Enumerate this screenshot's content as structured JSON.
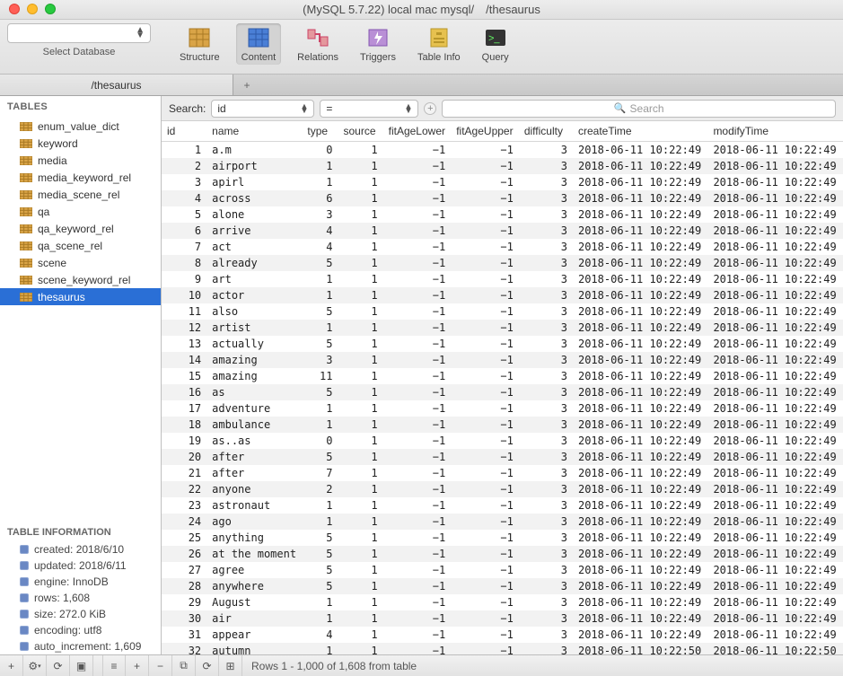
{
  "window": {
    "title": "(MySQL 5.7.22) local mac mysql/     /thesaurus"
  },
  "toolbar": {
    "selectDatabase": {
      "placeholder": "",
      "label": "Select Database"
    },
    "items": [
      {
        "key": "structure",
        "label": "Structure"
      },
      {
        "key": "content",
        "label": "Content"
      },
      {
        "key": "relations",
        "label": "Relations"
      },
      {
        "key": "triggers",
        "label": "Triggers"
      },
      {
        "key": "tableinfo",
        "label": "Table Info"
      },
      {
        "key": "query",
        "label": "Query"
      }
    ],
    "active": "content"
  },
  "tabs": {
    "items": [
      "/thesaurus"
    ]
  },
  "sidebar": {
    "heading": "TABLES",
    "tables": [
      "enum_value_dict",
      "keyword",
      "media",
      "media_keyword_rel",
      "media_scene_rel",
      "qa",
      "qa_keyword_rel",
      "qa_scene_rel",
      "scene",
      "scene_keyword_rel",
      "thesaurus"
    ],
    "selected": "thesaurus",
    "info": {
      "heading": "TABLE INFORMATION",
      "rows": [
        "created: 2018/6/10",
        "updated: 2018/6/11",
        "engine: InnoDB",
        "rows: 1,608",
        "size: 272.0 KiB",
        "encoding: utf8",
        "auto_increment: 1,609"
      ]
    }
  },
  "search": {
    "label": "Search:",
    "field": "id",
    "operator": "=",
    "placeholder": "Search"
  },
  "columns": [
    "id",
    "name",
    "type",
    "source",
    "fitAgeLower",
    "fitAgeUpper",
    "difficulty",
    "createTime",
    "modifyTime"
  ],
  "rows": [
    {
      "id": 1,
      "name": "a.m",
      "type": 0,
      "source": 1,
      "fitAgeLower": -1,
      "fitAgeUpper": -1,
      "difficulty": 3,
      "createTime": "2018-06-11 10:22:49",
      "modifyTime": "2018-06-11 10:22:49"
    },
    {
      "id": 2,
      "name": "airport",
      "type": 1,
      "source": 1,
      "fitAgeLower": -1,
      "fitAgeUpper": -1,
      "difficulty": 3,
      "createTime": "2018-06-11 10:22:49",
      "modifyTime": "2018-06-11 10:22:49"
    },
    {
      "id": 3,
      "name": "apirl",
      "type": 1,
      "source": 1,
      "fitAgeLower": -1,
      "fitAgeUpper": -1,
      "difficulty": 3,
      "createTime": "2018-06-11 10:22:49",
      "modifyTime": "2018-06-11 10:22:49"
    },
    {
      "id": 4,
      "name": "across",
      "type": 6,
      "source": 1,
      "fitAgeLower": -1,
      "fitAgeUpper": -1,
      "difficulty": 3,
      "createTime": "2018-06-11 10:22:49",
      "modifyTime": "2018-06-11 10:22:49"
    },
    {
      "id": 5,
      "name": "alone",
      "type": 3,
      "source": 1,
      "fitAgeLower": -1,
      "fitAgeUpper": -1,
      "difficulty": 3,
      "createTime": "2018-06-11 10:22:49",
      "modifyTime": "2018-06-11 10:22:49"
    },
    {
      "id": 6,
      "name": "arrive",
      "type": 4,
      "source": 1,
      "fitAgeLower": -1,
      "fitAgeUpper": -1,
      "difficulty": 3,
      "createTime": "2018-06-11 10:22:49",
      "modifyTime": "2018-06-11 10:22:49"
    },
    {
      "id": 7,
      "name": "act",
      "type": 4,
      "source": 1,
      "fitAgeLower": -1,
      "fitAgeUpper": -1,
      "difficulty": 3,
      "createTime": "2018-06-11 10:22:49",
      "modifyTime": "2018-06-11 10:22:49"
    },
    {
      "id": 8,
      "name": "already",
      "type": 5,
      "source": 1,
      "fitAgeLower": -1,
      "fitAgeUpper": -1,
      "difficulty": 3,
      "createTime": "2018-06-11 10:22:49",
      "modifyTime": "2018-06-11 10:22:49"
    },
    {
      "id": 9,
      "name": "art",
      "type": 1,
      "source": 1,
      "fitAgeLower": -1,
      "fitAgeUpper": -1,
      "difficulty": 3,
      "createTime": "2018-06-11 10:22:49",
      "modifyTime": "2018-06-11 10:22:49"
    },
    {
      "id": 10,
      "name": "actor",
      "type": 1,
      "source": 1,
      "fitAgeLower": -1,
      "fitAgeUpper": -1,
      "difficulty": 3,
      "createTime": "2018-06-11 10:22:49",
      "modifyTime": "2018-06-11 10:22:49"
    },
    {
      "id": 11,
      "name": "also",
      "type": 5,
      "source": 1,
      "fitAgeLower": -1,
      "fitAgeUpper": -1,
      "difficulty": 3,
      "createTime": "2018-06-11 10:22:49",
      "modifyTime": "2018-06-11 10:22:49"
    },
    {
      "id": 12,
      "name": "artist",
      "type": 1,
      "source": 1,
      "fitAgeLower": -1,
      "fitAgeUpper": -1,
      "difficulty": 3,
      "createTime": "2018-06-11 10:22:49",
      "modifyTime": "2018-06-11 10:22:49"
    },
    {
      "id": 13,
      "name": "actually",
      "type": 5,
      "source": 1,
      "fitAgeLower": -1,
      "fitAgeUpper": -1,
      "difficulty": 3,
      "createTime": "2018-06-11 10:22:49",
      "modifyTime": "2018-06-11 10:22:49"
    },
    {
      "id": 14,
      "name": "amazing",
      "type": 3,
      "source": 1,
      "fitAgeLower": -1,
      "fitAgeUpper": -1,
      "difficulty": 3,
      "createTime": "2018-06-11 10:22:49",
      "modifyTime": "2018-06-11 10:22:49"
    },
    {
      "id": 15,
      "name": "amazing",
      "type": 11,
      "source": 1,
      "fitAgeLower": -1,
      "fitAgeUpper": -1,
      "difficulty": 3,
      "createTime": "2018-06-11 10:22:49",
      "modifyTime": "2018-06-11 10:22:49"
    },
    {
      "id": 16,
      "name": "as",
      "type": 5,
      "source": 1,
      "fitAgeLower": -1,
      "fitAgeUpper": -1,
      "difficulty": 3,
      "createTime": "2018-06-11 10:22:49",
      "modifyTime": "2018-06-11 10:22:49"
    },
    {
      "id": 17,
      "name": "adventure",
      "type": 1,
      "source": 1,
      "fitAgeLower": -1,
      "fitAgeUpper": -1,
      "difficulty": 3,
      "createTime": "2018-06-11 10:22:49",
      "modifyTime": "2018-06-11 10:22:49"
    },
    {
      "id": 18,
      "name": "ambulance",
      "type": 1,
      "source": 1,
      "fitAgeLower": -1,
      "fitAgeUpper": -1,
      "difficulty": 3,
      "createTime": "2018-06-11 10:22:49",
      "modifyTime": "2018-06-11 10:22:49"
    },
    {
      "id": 19,
      "name": "as..as",
      "type": 0,
      "source": 1,
      "fitAgeLower": -1,
      "fitAgeUpper": -1,
      "difficulty": 3,
      "createTime": "2018-06-11 10:22:49",
      "modifyTime": "2018-06-11 10:22:49"
    },
    {
      "id": 20,
      "name": "after",
      "type": 5,
      "source": 1,
      "fitAgeLower": -1,
      "fitAgeUpper": -1,
      "difficulty": 3,
      "createTime": "2018-06-11 10:22:49",
      "modifyTime": "2018-06-11 10:22:49"
    },
    {
      "id": 21,
      "name": "after",
      "type": 7,
      "source": 1,
      "fitAgeLower": -1,
      "fitAgeUpper": -1,
      "difficulty": 3,
      "createTime": "2018-06-11 10:22:49",
      "modifyTime": "2018-06-11 10:22:49"
    },
    {
      "id": 22,
      "name": "anyone",
      "type": 2,
      "source": 1,
      "fitAgeLower": -1,
      "fitAgeUpper": -1,
      "difficulty": 3,
      "createTime": "2018-06-11 10:22:49",
      "modifyTime": "2018-06-11 10:22:49"
    },
    {
      "id": 23,
      "name": "astronaut",
      "type": 1,
      "source": 1,
      "fitAgeLower": -1,
      "fitAgeUpper": -1,
      "difficulty": 3,
      "createTime": "2018-06-11 10:22:49",
      "modifyTime": "2018-06-11 10:22:49"
    },
    {
      "id": 24,
      "name": "ago",
      "type": 1,
      "source": 1,
      "fitAgeLower": -1,
      "fitAgeUpper": -1,
      "difficulty": 3,
      "createTime": "2018-06-11 10:22:49",
      "modifyTime": "2018-06-11 10:22:49"
    },
    {
      "id": 25,
      "name": "anything",
      "type": 5,
      "source": 1,
      "fitAgeLower": -1,
      "fitAgeUpper": -1,
      "difficulty": 3,
      "createTime": "2018-06-11 10:22:49",
      "modifyTime": "2018-06-11 10:22:49"
    },
    {
      "id": 26,
      "name": "at the moment",
      "type": 5,
      "source": 1,
      "fitAgeLower": -1,
      "fitAgeUpper": -1,
      "difficulty": 3,
      "createTime": "2018-06-11 10:22:49",
      "modifyTime": "2018-06-11 10:22:49"
    },
    {
      "id": 27,
      "name": "agree",
      "type": 5,
      "source": 1,
      "fitAgeLower": -1,
      "fitAgeUpper": -1,
      "difficulty": 3,
      "createTime": "2018-06-11 10:22:49",
      "modifyTime": "2018-06-11 10:22:49"
    },
    {
      "id": 28,
      "name": "anywhere",
      "type": 5,
      "source": 1,
      "fitAgeLower": -1,
      "fitAgeUpper": -1,
      "difficulty": 3,
      "createTime": "2018-06-11 10:22:49",
      "modifyTime": "2018-06-11 10:22:49"
    },
    {
      "id": 29,
      "name": "August",
      "type": 1,
      "source": 1,
      "fitAgeLower": -1,
      "fitAgeUpper": -1,
      "difficulty": 3,
      "createTime": "2018-06-11 10:22:49",
      "modifyTime": "2018-06-11 10:22:49"
    },
    {
      "id": 30,
      "name": "air",
      "type": 1,
      "source": 1,
      "fitAgeLower": -1,
      "fitAgeUpper": -1,
      "difficulty": 3,
      "createTime": "2018-06-11 10:22:49",
      "modifyTime": "2018-06-11 10:22:49"
    },
    {
      "id": 31,
      "name": "appear",
      "type": 4,
      "source": 1,
      "fitAgeLower": -1,
      "fitAgeUpper": -1,
      "difficulty": 3,
      "createTime": "2018-06-11 10:22:49",
      "modifyTime": "2018-06-11 10:22:49"
    },
    {
      "id": 32,
      "name": "autumn",
      "type": 1,
      "source": 1,
      "fitAgeLower": -1,
      "fitAgeUpper": -1,
      "difficulty": 3,
      "createTime": "2018-06-11 10:22:50",
      "modifyTime": "2018-06-11 10:22:50"
    }
  ],
  "footer": {
    "status": "Rows 1 - 1,000 of 1,608 from table"
  }
}
